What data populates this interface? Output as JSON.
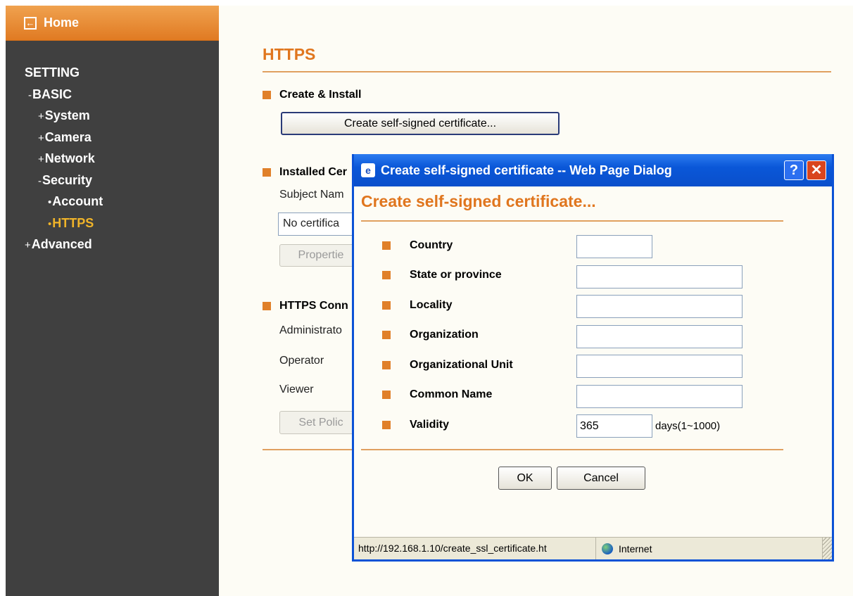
{
  "sidebar": {
    "home_label": "Home",
    "items": [
      {
        "sym": "",
        "label": "SETTING"
      },
      {
        "sym": "-",
        "label": "BASIC"
      },
      {
        "sym": "+",
        "label": "System"
      },
      {
        "sym": "+",
        "label": "Camera"
      },
      {
        "sym": "+",
        "label": "Network"
      },
      {
        "sym": "-",
        "label": "Security"
      },
      {
        "sym": "•",
        "label": "Account"
      },
      {
        "sym": "•",
        "label": "HTTPS"
      },
      {
        "sym": "+",
        "label": "Advanced"
      }
    ],
    "active_item": "HTTPS"
  },
  "main": {
    "title": "HTTPS",
    "create_install": {
      "heading": "Create & Install",
      "create_button": "Create self-signed certificate..."
    },
    "installed": {
      "heading": "Installed Cer",
      "subject_label": "Subject Nam",
      "subject_value": "No certifica",
      "properties_button": "Propertie"
    },
    "https_conn": {
      "heading": "HTTPS Conn",
      "rows": [
        "Administrato",
        "Operator",
        "Viewer"
      ],
      "set_policy_button": "Set Polic"
    }
  },
  "dialog": {
    "window_title": "Create self-signed certificate -- Web Page Dialog",
    "help_glyph": "?",
    "close_glyph": "✕",
    "heading": "Create self-signed certificate...",
    "fields": [
      {
        "label": "Country",
        "value": ""
      },
      {
        "label": "State or province",
        "value": ""
      },
      {
        "label": "Locality",
        "value": ""
      },
      {
        "label": "Organization",
        "value": ""
      },
      {
        "label": "Organizational Unit",
        "value": ""
      },
      {
        "label": "Common Name",
        "value": ""
      },
      {
        "label": "Validity",
        "value": "365",
        "suffix": "days(1~1000)"
      }
    ],
    "ok_label": "OK",
    "cancel_label": "Cancel",
    "status_url": "http://192.168.1.10/create_ssl_certificate.ht",
    "status_zone": "Internet"
  },
  "colors": {
    "accent": "#e0761e",
    "sidebar_bg": "#404040",
    "active_nav": "#f0b429",
    "xp_blue": "#0a57d8"
  }
}
